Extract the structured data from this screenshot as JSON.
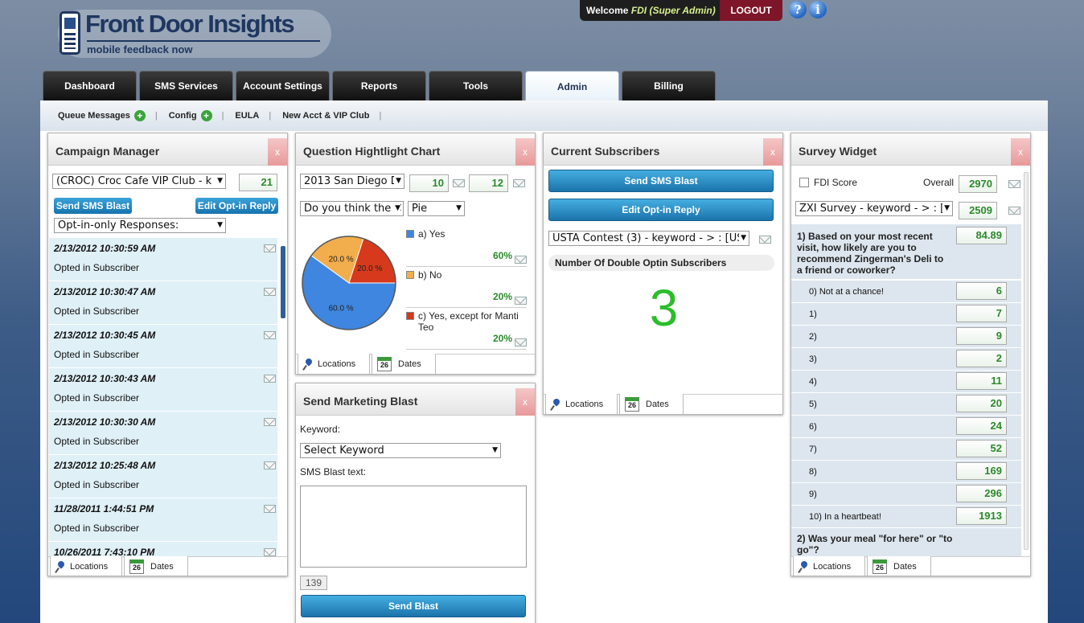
{
  "brand": {
    "name": "Front Door Insights",
    "tagline": "mobile feedback now"
  },
  "header": {
    "welcome": "Welcome",
    "user": "FDI (Super Admin)",
    "logout": "LOGOUT",
    "help_icon": "question-icon",
    "info_icon": "info-icon"
  },
  "tabs": [
    "Dashboard",
    "SMS Services",
    "Account Settings",
    "Reports",
    "Tools",
    "Admin",
    "Billing"
  ],
  "active_tab": "Admin",
  "subnav": [
    {
      "label": "Queue Messages",
      "plus": true
    },
    {
      "label": "Config",
      "plus": true
    },
    {
      "label": "EULA",
      "plus": false
    },
    {
      "label": "New Acct & VIP Club",
      "plus": false
    }
  ],
  "campaign": {
    "title": "Campaign Manager",
    "close": "x",
    "select": "(CROC) Croc Cafe VIP Club - k",
    "count": "21",
    "send": "Send SMS Blast",
    "edit": "Edit Opt-in Reply",
    "filter": "Opt-in-only Responses:",
    "items": [
      {
        "date": "2/13/2012 10:30:59 AM",
        "status": "Opted in Subscriber"
      },
      {
        "date": "2/13/2012 10:30:47 AM",
        "status": "Opted in Subscriber"
      },
      {
        "date": "2/13/2012 10:30:45 AM",
        "status": "Opted in Subscriber"
      },
      {
        "date": "2/13/2012 10:30:43 AM",
        "status": "Opted in Subscriber"
      },
      {
        "date": "2/13/2012 10:30:30 AM",
        "status": "Opted in Subscriber"
      },
      {
        "date": "2/13/2012 10:25:48 AM",
        "status": "Opted in Subscriber"
      },
      {
        "date": "11/28/2011 1:44:51 PM",
        "status": "Opted in Subscriber"
      },
      {
        "date": "10/26/2011 7:43:10 PM",
        "status": ""
      }
    ],
    "tab_locations": "Locations",
    "tab_dates": "Dates",
    "cal_day": "26"
  },
  "qchart": {
    "title": "Question Hightlight Chart",
    "close": "x",
    "select1": "2013 San Diego D",
    "n1": "10",
    "n2": "12",
    "select2": "Do you think the C",
    "type": "Pie",
    "tab_locations": "Locations",
    "tab_dates": "Dates",
    "cal_day": "26"
  },
  "chart_data": {
    "type": "pie",
    "categories": [
      "a) Yes",
      "b) No",
      "c) Yes, except for Manti Teo"
    ],
    "values": [
      60,
      20,
      20
    ],
    "labels": [
      "60%",
      "20%",
      "20%"
    ],
    "slice_labels": [
      "60.0 %",
      "20.0 %",
      "20.0 %"
    ],
    "colors": [
      "#3f86e0",
      "#f2ad4c",
      "#d6391c"
    ]
  },
  "blast": {
    "title": "Send Marketing Blast",
    "close": "x",
    "keyword_label": "Keyword:",
    "keyword_select": "Select Keyword",
    "text_label": "SMS Blast text:",
    "counter": "139",
    "send": "Send Blast"
  },
  "subs": {
    "title": "Current Subscribers",
    "close": "x",
    "send": "Send SMS Blast",
    "edit": "Edit Opt-in Reply",
    "select": "USTA Contest (3) - keyword - > : [US",
    "caption": "Number Of Double Optin Subscribers",
    "count": "3",
    "tab_locations": "Locations",
    "tab_dates": "Dates",
    "cal_day": "26"
  },
  "survey": {
    "title": "Survey Widget",
    "close": "x",
    "fdi": "FDI Score",
    "overall": "Overall",
    "overall_val": "2970",
    "select": "ZXI Survey - keyword - > : [2",
    "select_val": "2509",
    "q1": "1) Based on your most recent visit, how likely are you to recommend Zingerman's Deli to a friend or coworker?",
    "q1_val": "84.89",
    "rows": [
      {
        "label": "0) Not at a chance!",
        "val": "6"
      },
      {
        "label": "1)",
        "val": "7"
      },
      {
        "label": "2)",
        "val": "9"
      },
      {
        "label": "3)",
        "val": "2"
      },
      {
        "label": "4)",
        "val": "11"
      },
      {
        "label": "5)",
        "val": "20"
      },
      {
        "label": "6)",
        "val": "24"
      },
      {
        "label": "7)",
        "val": "52"
      },
      {
        "label": "8)",
        "val": "169"
      },
      {
        "label": "9)",
        "val": "296"
      },
      {
        "label": "10) In a heartbeat!",
        "val": "1913"
      }
    ],
    "q2": "2) Was your meal \"for here\" or \"to go\"?",
    "tab_locations": "Locations",
    "tab_dates": "Dates",
    "cal_day": "26"
  }
}
